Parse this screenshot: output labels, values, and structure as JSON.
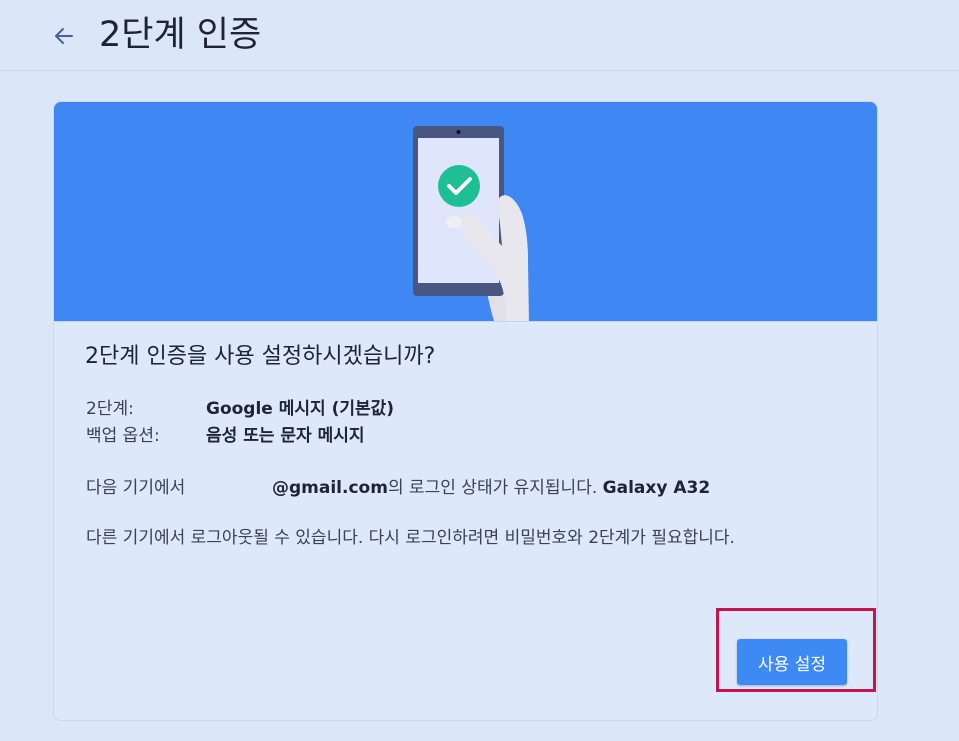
{
  "header": {
    "title": "2단계 인증",
    "back_icon": "arrow-left-icon"
  },
  "colors": {
    "banner": "#3f87f2",
    "button": "#3d8af5",
    "highlight": "#c5144c",
    "check": "#1fbf96"
  },
  "dialog": {
    "question": "2단계 인증을 사용 설정하시겠습니까?",
    "step_label": "2단계:",
    "step_value": "Google 메시지 (기본값)",
    "backup_label": "백업 옵션:",
    "backup_value": "음성 또는 문자 메시지",
    "device_label": "다음 기기에서",
    "device_email": "@gmail.com",
    "device_text": "의 로그인 상태가 유지됩니다.",
    "device_name": "Galaxy A32",
    "logout_note": "다른 기기에서 로그아웃될 수 있습니다. 다시 로그인하려면 비밀번호와 2단계가 필요합니다.",
    "enable_button": "사용 설정"
  }
}
